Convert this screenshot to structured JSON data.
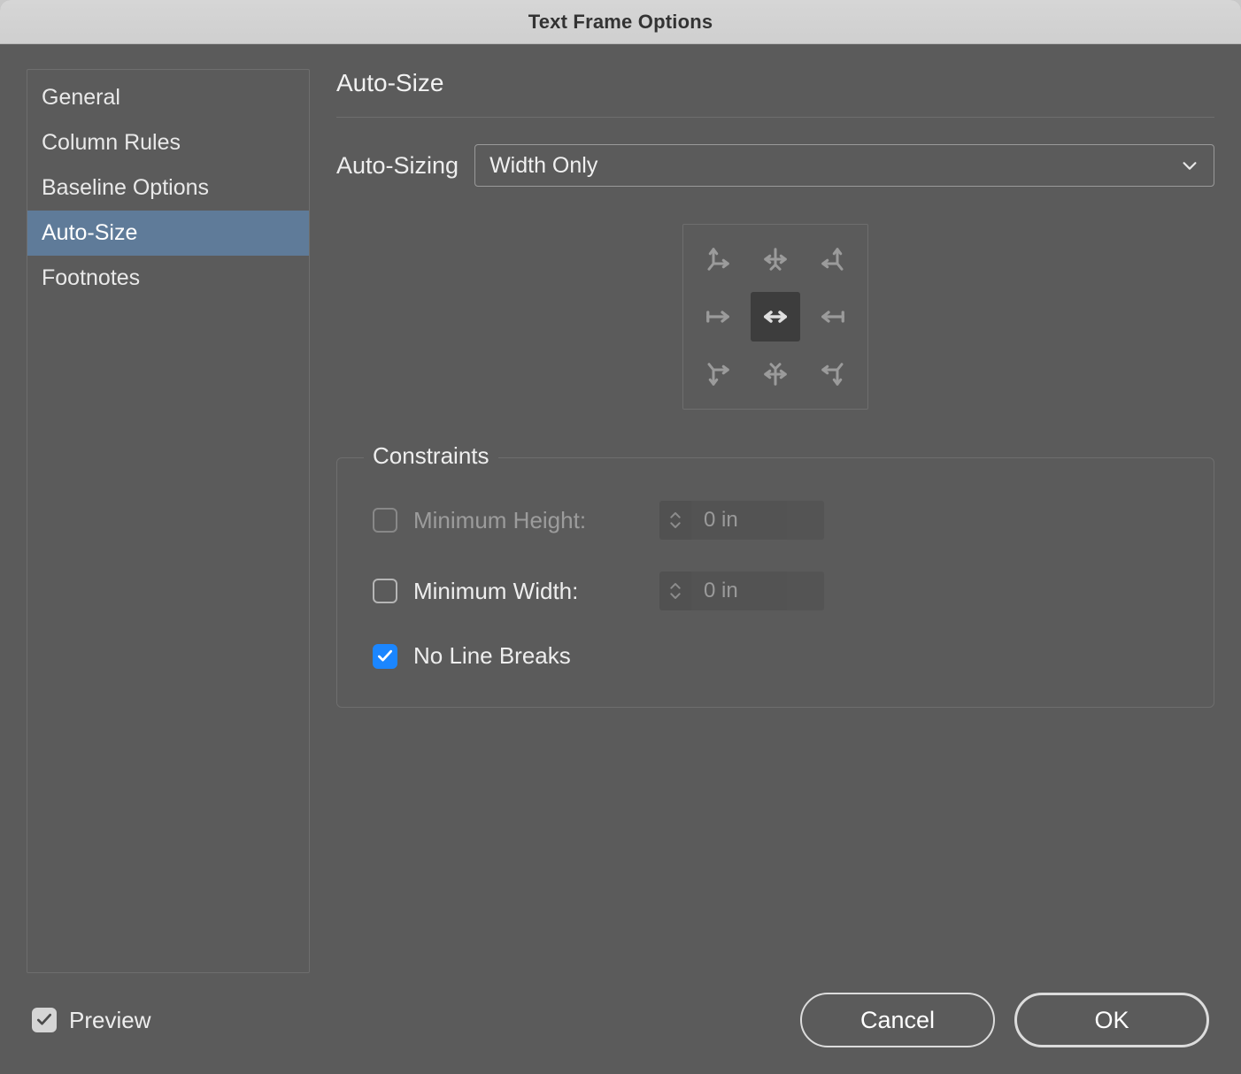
{
  "title": "Text Frame Options",
  "sidebar": {
    "items": [
      {
        "label": "General",
        "selected": false
      },
      {
        "label": "Column Rules",
        "selected": false
      },
      {
        "label": "Baseline Options",
        "selected": false
      },
      {
        "label": "Auto-Size",
        "selected": true
      },
      {
        "label": "Footnotes",
        "selected": false
      }
    ]
  },
  "panel": {
    "title": "Auto-Size",
    "select_label": "Auto-Sizing",
    "select_value": "Width Only"
  },
  "constraints": {
    "legend": "Constraints",
    "min_height": {
      "label": "Minimum Height:",
      "value": "0 in",
      "checked": false,
      "enabled": false
    },
    "min_width": {
      "label": "Minimum Width:",
      "value": "0 in",
      "checked": false,
      "enabled": true
    },
    "no_breaks": {
      "label": "No Line Breaks",
      "checked": true
    }
  },
  "footer": {
    "preview": {
      "label": "Preview",
      "checked": true
    },
    "cancel": "Cancel",
    "ok": "OK"
  }
}
